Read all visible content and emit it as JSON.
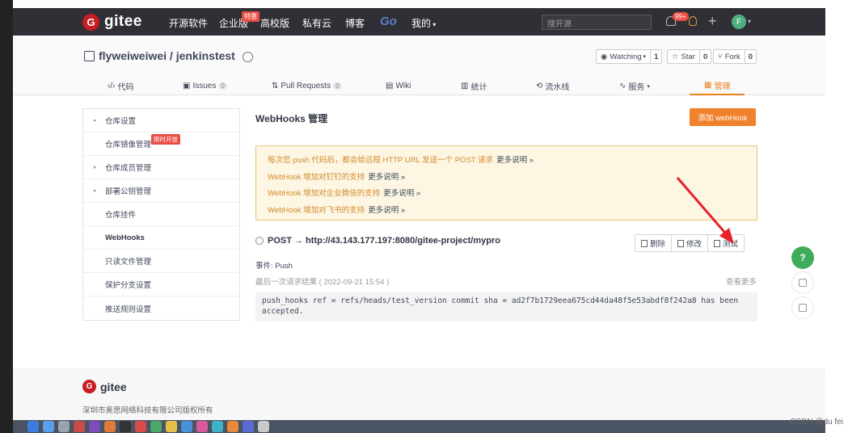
{
  "topnav": {
    "logo_text": "gitee",
    "logo_mark": "G",
    "links": [
      "开源软件",
      "企业版",
      "高校版",
      "私有云",
      "博客"
    ],
    "enterprise_badge": "特惠",
    "go_label": "Go",
    "mine_label": "我的",
    "search_placeholder": "搜开源",
    "notification_count": "99+",
    "avatar_letter": "F"
  },
  "repo": {
    "name": "flyweiweiwei / jenkinstest",
    "watching_label": "Watching",
    "watching_count": "1",
    "star_label": "Star",
    "star_count": "0",
    "fork_label": "Fork",
    "fork_count": "0"
  },
  "tabs": [
    {
      "label": "代码",
      "count": ""
    },
    {
      "label": "Issues",
      "count": "0"
    },
    {
      "label": "Pull Requests",
      "count": "0"
    },
    {
      "label": "Wiki",
      "count": ""
    },
    {
      "label": "统计",
      "count": ""
    },
    {
      "label": "流水线",
      "count": ""
    },
    {
      "label": "服务",
      "count": ""
    },
    {
      "label": "管理",
      "count": ""
    }
  ],
  "sidebar": {
    "items": [
      {
        "label": "仓库设置",
        "arrow": true
      },
      {
        "label": "仓库镜像管理",
        "arrow": false
      },
      {
        "label": "仓库成员管理",
        "arrow": true
      },
      {
        "label": "部署公钥管理",
        "arrow": true
      },
      {
        "label": "仓库挂件",
        "arrow": false
      },
      {
        "label": "WebHooks",
        "arrow": false
      },
      {
        "label": "只读文件管理",
        "arrow": false
      },
      {
        "label": "保护分支设置",
        "arrow": false
      },
      {
        "label": "推送规则设置",
        "arrow": false
      }
    ],
    "mirror_badge": "限时开放"
  },
  "main": {
    "title": "WebHooks 管理",
    "add_button": "添加 webHook",
    "notice": [
      {
        "text": "每次您 push 代码后，都会给远程 HTTP URL 发送一个 POST 请求",
        "more": "更多说明 »"
      },
      {
        "text": "WebHook 增加对钉钉的支持",
        "more": "更多说明 »"
      },
      {
        "text": "WebHook 增加对企业微信的支持",
        "more": "更多说明 »"
      },
      {
        "text": "WebHook 增加对飞书的支持",
        "more": "更多说明 »"
      }
    ],
    "hook_url": "POST → http://43.143.177.197:8080/gitee-project/mypro",
    "delete_label": "删除",
    "edit_label": "修改",
    "test_label": "测试",
    "event_line": "事件:  Push",
    "last_result": "最后一次请求结果 ( 2022-09-21 15:54 )",
    "see_more": "查看更多",
    "log_text": "push_hooks ref = refs/heads/test_version commit sha = ad2f7b1729eea675cd44da48f5e53abdf8f242a8 has been accepted."
  },
  "floating": {
    "help": "?"
  },
  "footer": {
    "logo_text": "gitee",
    "company": "深圳市奥思网络科技有限公司版权所有"
  },
  "watermark": "CSDN @du fei",
  "colors": {
    "accent": "#f0822d",
    "brand": "#c71d23",
    "nav_bg": "#2f2f35",
    "arrow": "#e8202a"
  }
}
